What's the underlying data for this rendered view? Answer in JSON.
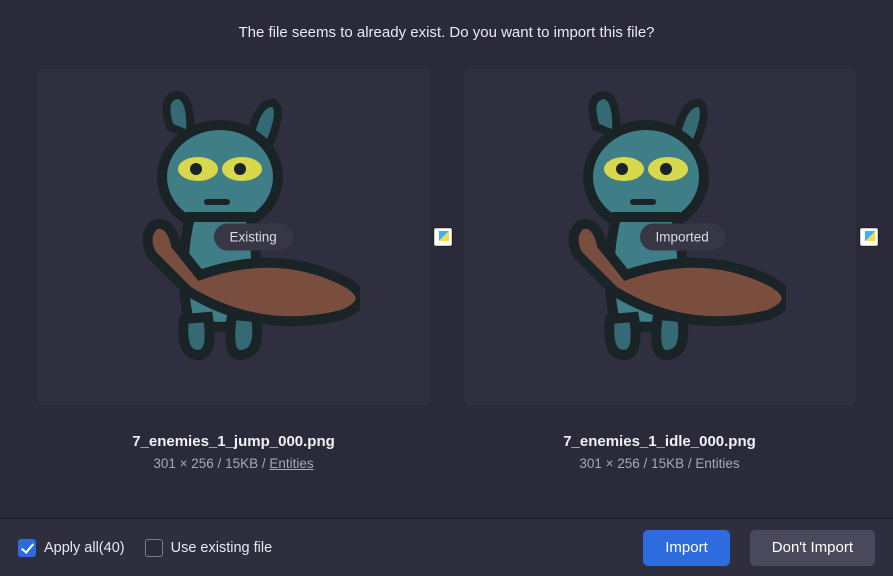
{
  "header": {
    "message": "The file seems to already exist. Do you want to import this file?"
  },
  "left": {
    "badge": "Existing",
    "filename": "7_enemies_1_jump_000.png",
    "dims": "301 × 256",
    "size": "15KB",
    "category": "Entities",
    "category_clickable": true
  },
  "right": {
    "badge": "Imported",
    "filename": "7_enemies_1_idle_000.png",
    "dims": "301 × 256",
    "size": "15KB",
    "category": "Entities",
    "category_clickable": false
  },
  "footer": {
    "apply_all_label": "Apply all(40)",
    "use_existing_label": "Use existing file",
    "import_label": "Import",
    "dont_import_label": "Don't Import"
  }
}
